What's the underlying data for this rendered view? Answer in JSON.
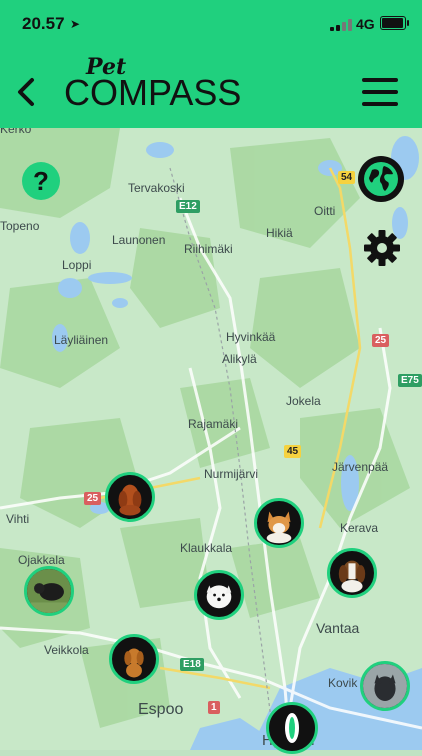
{
  "status": {
    "time": "20.57",
    "network": "4G",
    "battery_level": 0.9
  },
  "header": {
    "logo_pet": "Pet",
    "logo_compass": "COMPASS"
  },
  "map": {
    "places": {
      "kerko": "Kerko",
      "tervakoski": "Tervakoski",
      "oitti": "Oitti",
      "topeno": "Topeno",
      "launonen": "Launonen",
      "riihimaki": "Riihimäki",
      "hikia": "Hikiä",
      "loppi": "Loppi",
      "layliainen": "Läyliäinen",
      "hyvinkaa": "Hyvinkää",
      "alikyla": "Alikylä",
      "jokela": "Jokela",
      "rajamaki": "Rajamäki",
      "nurmijarvi": "Nurmijärvi",
      "jarvenpaa": "Järvenpää",
      "vihti": "Vihti",
      "kerava": "Kerava",
      "ojakkala": "Ojakkala",
      "klaukkala": "Klaukkala",
      "vantaa": "Vantaa",
      "veikkola": "Veikkola",
      "kovik": "Kovik",
      "espoo": "Espoo",
      "helsinki": "Helsinki"
    },
    "shields": {
      "s54": "54",
      "e12": "E12",
      "s25a": "25",
      "e75": "E75",
      "s45": "45",
      "s25b": "25",
      "e18": "E18",
      "s1": "1"
    }
  },
  "buttons": {
    "help_label": "?"
  },
  "colors": {
    "brand_green": "#20d07e",
    "map_bg": "#bfe3c3",
    "water": "#9ccaf0",
    "forest": "#a8d8a0"
  }
}
